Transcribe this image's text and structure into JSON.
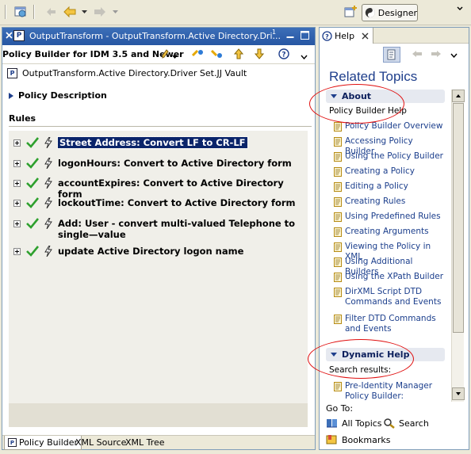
{
  "toolbar": {
    "perspective_label": "Designer"
  },
  "editor": {
    "tab_title": "OutputTransform - OutputTransform.Active Directory.Dri...",
    "tab_badge": "1",
    "title": "Policy Builder for IDM 3.5 and Newer",
    "vault_path": "OutputTransform.Active Directory.Driver Set.JJ Vault",
    "policy_description_label": "Policy Description",
    "rules_label": "Rules",
    "rules": [
      {
        "name": "Street Address: Convert LF to CR-LF"
      },
      {
        "name": "logonHours: Convert to Active Directory form"
      },
      {
        "name": "accountExpires: Convert to Active Directory form"
      },
      {
        "name": "lockoutTime: Convert to Active Directory form"
      },
      {
        "name": "Add: User - convert multi-valued Telephone to single—value"
      },
      {
        "name": "update Active Directory logon name"
      }
    ],
    "bottom_tabs": [
      "Policy Builder",
      "XML Source",
      "XML Tree"
    ]
  },
  "help": {
    "tab_label": "Help",
    "heading": "Related Topics",
    "about": {
      "header": "About",
      "subtitle": "Policy Builder Help",
      "topics": [
        "Policy Builder Overview",
        "Accessing Policy Builder",
        "Using the Policy Builder",
        "Creating a Policy",
        "Editing a Policy",
        "Creating Rules",
        "Using Predefined Rules",
        "Creating Arguments",
        "Viewing the Policy in XML",
        "Using Additional Builders",
        "Using the XPath Builder",
        "DirXML Script DTD Commands and Events",
        "Filter DTD Commands and Events"
      ]
    },
    "dynamic": {
      "header": "Dynamic Help",
      "subtitle": "Search results:",
      "topics": [
        "Pre-Identity Manager Policy Builder: Overview"
      ]
    },
    "goto_label": "Go To:",
    "links": {
      "all_topics": "All Topics",
      "search": "Search",
      "bookmarks": "Bookmarks"
    }
  },
  "colors": {
    "accent": "#2756a3",
    "link": "#1b3e8c",
    "check": "#2ea02e",
    "annotation": "#e01010"
  }
}
